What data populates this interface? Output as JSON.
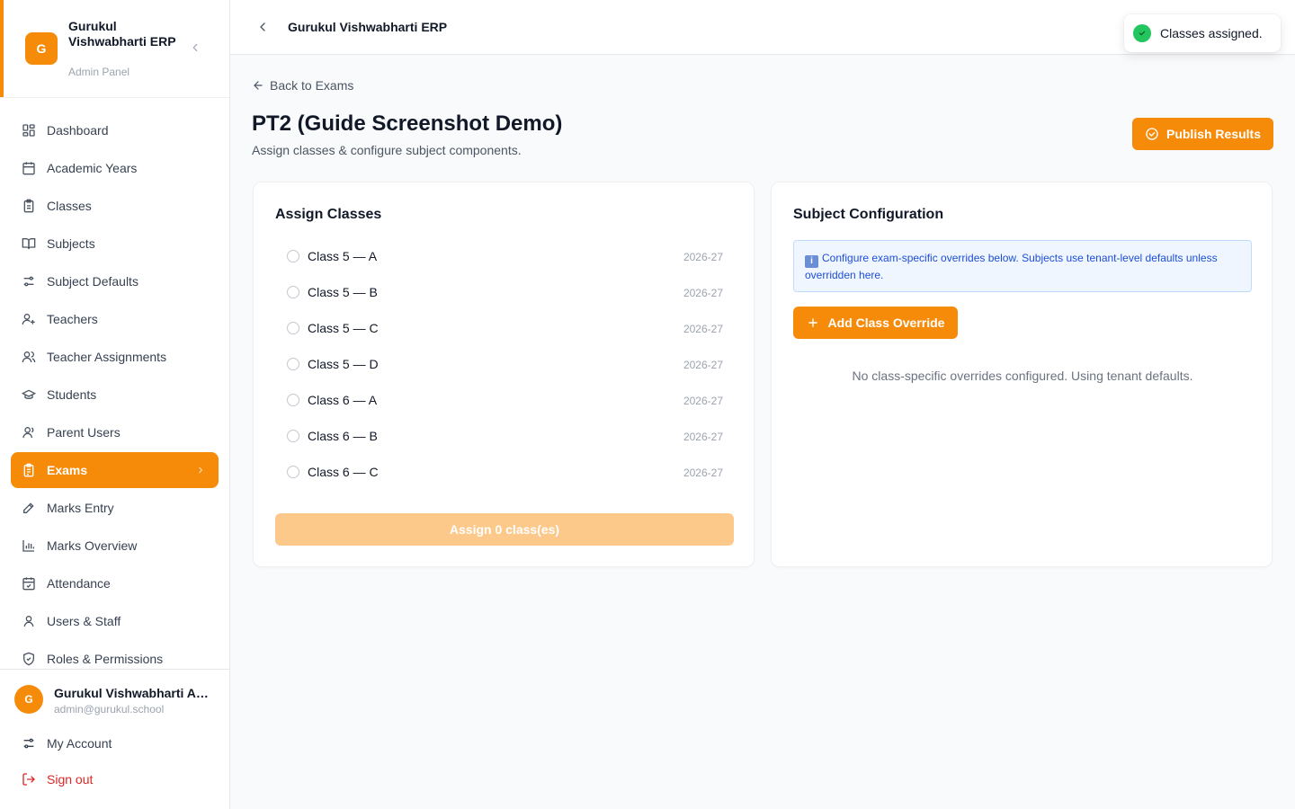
{
  "brand": {
    "logo_letter": "G",
    "name": "Gurukul Vishwabharti ERP",
    "subtitle": "Admin Panel"
  },
  "nav": [
    {
      "label": "Dashboard",
      "icon": "dashboard-icon",
      "active": false
    },
    {
      "label": "Academic Years",
      "icon": "calendar-icon",
      "active": false
    },
    {
      "label": "Classes",
      "icon": "clipboard-icon",
      "active": false
    },
    {
      "label": "Subjects",
      "icon": "book-icon",
      "active": false
    },
    {
      "label": "Subject Defaults",
      "icon": "sliders-icon",
      "active": false
    },
    {
      "label": "Teachers",
      "icon": "teacher-icon",
      "active": false
    },
    {
      "label": "Teacher Assignments",
      "icon": "users-icon",
      "active": false
    },
    {
      "label": "Students",
      "icon": "graduation-cap-icon",
      "active": false
    },
    {
      "label": "Parent Users",
      "icon": "user-group-icon",
      "active": false
    },
    {
      "label": "Exams",
      "icon": "clipboard-list-icon",
      "active": true
    },
    {
      "label": "Marks Entry",
      "icon": "pencil-icon",
      "active": false
    },
    {
      "label": "Marks Overview",
      "icon": "bar-chart-icon",
      "active": false
    },
    {
      "label": "Attendance",
      "icon": "calendar-check-icon",
      "active": false
    },
    {
      "label": "Users & Staff",
      "icon": "user-icon",
      "active": false
    },
    {
      "label": "Roles & Permissions",
      "icon": "shield-icon",
      "active": false
    }
  ],
  "footer": {
    "avatar_letter": "G",
    "user_name": "Gurukul Vishwabharti Admin",
    "user_email": "admin@gurukul.school",
    "account_label": "My Account",
    "signout_label": "Sign out"
  },
  "header": {
    "title": "Gurukul Vishwabharti ERP"
  },
  "toast": {
    "message": "Classes assigned."
  },
  "page": {
    "back_label": "Back to Exams",
    "title": "PT2 (Guide Screenshot Demo)",
    "subtitle": "Assign classes & configure subject components.",
    "publish_label": "Publish Results"
  },
  "assign": {
    "title": "Assign Classes",
    "classes": [
      {
        "label": "Class 5 — A",
        "year": "2026-27"
      },
      {
        "label": "Class 5 — B",
        "year": "2026-27"
      },
      {
        "label": "Class 5 — C",
        "year": "2026-27"
      },
      {
        "label": "Class 5 — D",
        "year": "2026-27"
      },
      {
        "label": "Class 6 — A",
        "year": "2026-27"
      },
      {
        "label": "Class 6 — B",
        "year": "2026-27"
      },
      {
        "label": "Class 6 — C",
        "year": "2026-27"
      }
    ],
    "button_label": "Assign 0 class(es)"
  },
  "subject": {
    "title": "Subject Configuration",
    "info_glyph": "i",
    "info_text": "Configure exam-specific overrides below. Subjects use tenant-level defaults unless overridden here.",
    "override_label": "Add Class Override",
    "empty_text": "No class-specific overrides configured. Using tenant defaults."
  },
  "colors": {
    "accent": "#f68b0a",
    "accent_disabled": "#fcc98a",
    "danger": "#dc2626",
    "success": "#22c55e",
    "info": "#1d4ed8"
  }
}
